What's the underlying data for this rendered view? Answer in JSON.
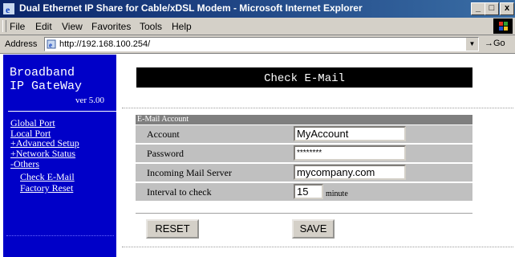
{
  "window": {
    "title": "Dual Ethernet IP Share for Cable/xDSL Modem - Microsoft Internet Explorer",
    "controls": [
      "_",
      "□",
      "x"
    ]
  },
  "menu": [
    {
      "label": "File"
    },
    {
      "label": "Edit"
    },
    {
      "label": "View"
    },
    {
      "label": "Favorites"
    },
    {
      "label": "Tools"
    },
    {
      "label": "Help"
    }
  ],
  "address": {
    "label": "Address",
    "url": "http://192.168.100.254/",
    "go_label": "→Go"
  },
  "sidebar": {
    "brand_line1": "Broadband",
    "brand_line2": "IP GateWay",
    "version": "ver 5.00",
    "nav": [
      {
        "label": "Global Port"
      },
      {
        "label": "Local Port"
      },
      {
        "label": "+Advanced Setup"
      },
      {
        "label": "+Network Status"
      },
      {
        "label": "-Others"
      },
      {
        "label": "Check E-Mail"
      },
      {
        "label": "Factory Reset"
      }
    ]
  },
  "main": {
    "title": "Check E-Mail",
    "section_header": "E-Mail Account",
    "fields": {
      "account": {
        "label": "Account",
        "value": "MyAccount"
      },
      "password": {
        "label": "Password",
        "value": "********"
      },
      "server": {
        "label": "Incoming Mail Server",
        "value": "mycompany.com"
      },
      "interval": {
        "label": "Interval to check",
        "value": "15",
        "unit": "minute"
      }
    },
    "buttons": {
      "reset": "RESET",
      "save": "SAVE"
    }
  },
  "colors": {
    "sidebar_bg": "#0000c8",
    "banner_bg": "#000000",
    "panel_header": "#7f7f7f",
    "row_bg": "#c0c0c0"
  }
}
